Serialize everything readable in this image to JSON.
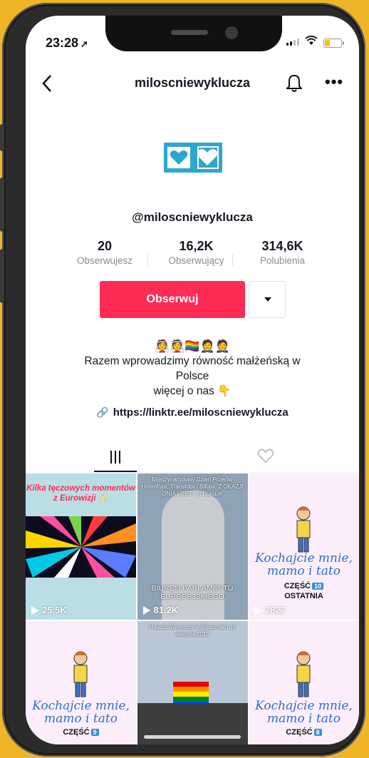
{
  "status_bar": {
    "time": "23:28"
  },
  "header": {
    "title": "miloscniewyklucza"
  },
  "profile": {
    "handle": "@miloscniewyklucza",
    "stats": [
      {
        "value": "20",
        "label": "Obserwujesz"
      },
      {
        "value": "16,2K",
        "label": "Obserwujący"
      },
      {
        "value": "314,6K",
        "label": "Polubienia"
      }
    ],
    "follow_label": "Obserwuj",
    "emojis": "👰👰🏳️‍🌈🤵🤵",
    "bio_line1": "Razem wprowadzimy równość małżeńską w",
    "bio_line2": "Polsce",
    "bio_line3": "więcej o nas 👇",
    "link": "https://linktr.ee/miloscniewyklucza"
  },
  "videos": [
    {
      "caption": "Kilka tęczowych momentów z Eurowizji ✨",
      "views": "25,5K"
    },
    {
      "caption_top": "Międzynarodowy Dzień Przeciw Homofobii, Transfobii i Bifobii. Z OKAZJI DNIA LGBT+ w Europie",
      "caption_mid": "BIUREM PARLAMENTU EUROPEJSKIEGO",
      "views": "81,2K"
    },
    {
      "title": "Kochajcie mnie, mamo i tato",
      "part": "CZĘŚĆ",
      "part_num": "10",
      "extra": "OSTATNIA",
      "views": "2827"
    },
    {
      "title": "Kochajcie mnie, mamo i tato",
      "part": "CZĘŚĆ",
      "part_num": "9"
    },
    {
      "caption_top": "I Marsz Równości w Radomsku 17 sierpnia 2019"
    },
    {
      "title": "Kochajcie mnie, mamo i tato",
      "part": "CZĘŚĆ",
      "part_num": "8"
    }
  ],
  "colors": {
    "accent": "#fe2c55",
    "avatar": "#2ea6cf",
    "background": "#f0b429"
  }
}
